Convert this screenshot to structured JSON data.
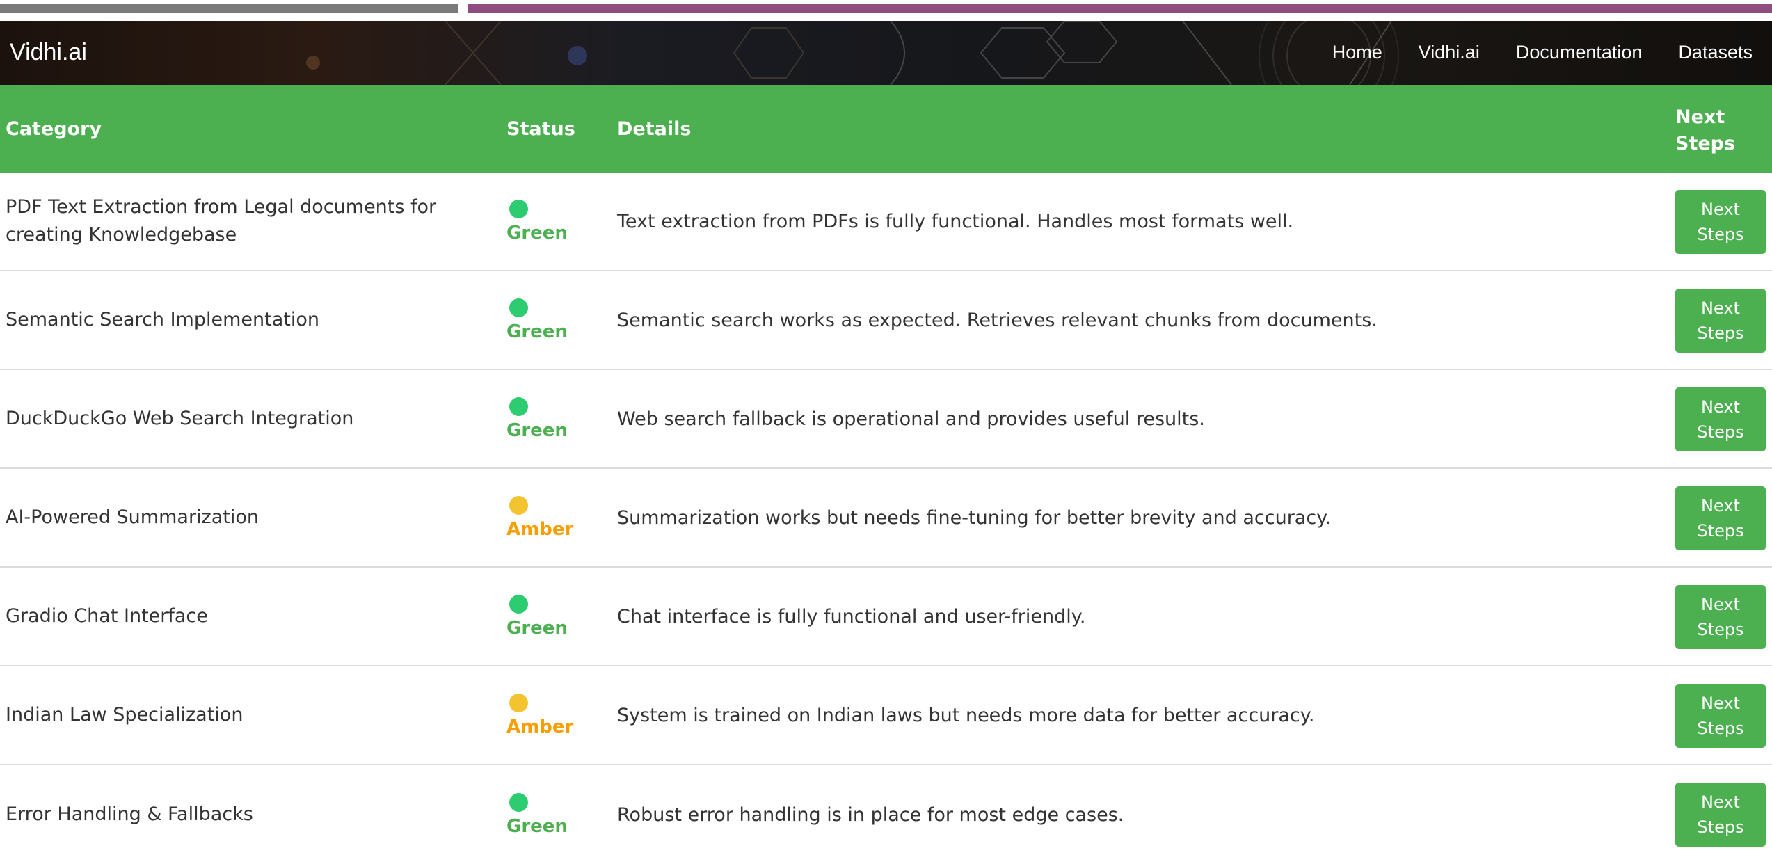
{
  "navbar": {
    "brand": "Vidhi.ai",
    "links": [
      "Home",
      "Vidhi.ai",
      "Documentation",
      "Datasets"
    ]
  },
  "table": {
    "headers": {
      "category": "Category",
      "status": "Status",
      "details": "Details",
      "next_steps": "Next Steps"
    },
    "rows": [
      {
        "category": "PDF Text Extraction from Legal documents for creating Knowledgebase",
        "status": "Green",
        "details": "Text extraction from PDFs is fully functional. Handles most formats well.",
        "button": "Next Steps"
      },
      {
        "category": "Semantic Search Implementation",
        "status": "Green",
        "details": "Semantic search works as expected. Retrieves relevant chunks from documents.",
        "button": "Next Steps"
      },
      {
        "category": "DuckDuckGo Web Search Integration",
        "status": "Green",
        "details": "Web search fallback is operational and provides useful results.",
        "button": "Next Steps"
      },
      {
        "category": "AI-Powered Summarization",
        "status": "Amber",
        "details": "Summarization works but needs fine-tuning for better brevity and accuracy.",
        "button": "Next Steps"
      },
      {
        "category": "Gradio Chat Interface",
        "status": "Green",
        "details": "Chat interface is fully functional and user-friendly.",
        "button": "Next Steps"
      },
      {
        "category": "Indian Law Specialization",
        "status": "Amber",
        "details": "System is trained on Indian laws but needs more data for better accuracy.",
        "button": "Next Steps"
      },
      {
        "category": "Error Handling & Fallbacks",
        "status": "Green",
        "details": "Robust error handling is in place for most edge cases.",
        "button": "Next Steps"
      }
    ]
  },
  "colors": {
    "header_green": "#4caf50",
    "dot_green": "#2ecc71",
    "dot_amber": "#f4c430",
    "label_green": "#4caf50",
    "label_amber": "#f5a000",
    "top_bar_grey": "#7a7a7a",
    "top_bar_purple": "#8f4c7f"
  }
}
